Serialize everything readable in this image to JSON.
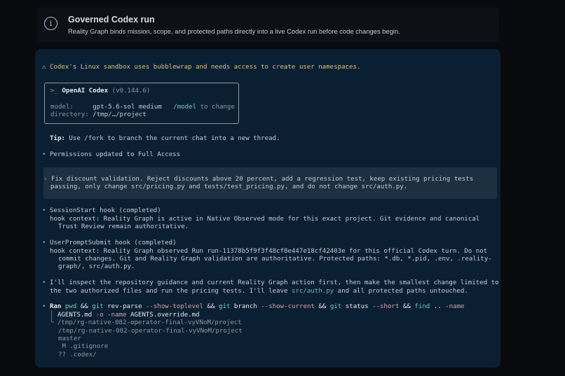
{
  "banner": {
    "icon": "info-icon",
    "title": "Governed Codex run",
    "description": "Reality Graph binds mission, scope, and protected paths directly into a live Codex run before code changes begin."
  },
  "terminal": {
    "warning": "⚠ Codex's Linux sandbox uses bubblewrap and needs access to create user namespaces.",
    "header": {
      "prompt": ">_",
      "app_name": "OpenAI Codex",
      "version": "(v0.144.6)",
      "model_label": "model:",
      "model_value": "gpt-5.6-sol medium",
      "model_cmd": "/model",
      "model_hint": "to change",
      "dir_label": "directory:",
      "dir_value": "/tmp/…/project"
    },
    "tip": {
      "label": "Tip:",
      "text": "Use /fork to branch the current chat into a new thread."
    },
    "permissions": "Permissions updated to Full Access",
    "user_prompt": {
      "line1": "Fix discount validation. Reject discounts above 20 percent, add a regression test, keep existing pricing tests",
      "line2": "passing, only change src/pricing.py and tests/test_pricing.py, and do not change src/auth.py."
    },
    "session_hook": {
      "title": "SessionStart hook (completed)",
      "line1": "hook context: Reality Graph is active in Native Observed mode for this exact project. Git evidence and canonical",
      "line2": "Trust Review remain authoritative."
    },
    "prompt_hook": {
      "title": "UserPromptSubmit hook (completed)",
      "line1": "hook context: Reality Graph observed Run run-11378b5f9f3f48cf8e447e18cf42403e for this official Codex turn. Do not",
      "line2": "commit changes. Git and Reality Graph validation are authoritative. Protected paths: *.db, *.pid, .env, .reality-",
      "line3": "graph/, src/auth.py."
    },
    "assistant": {
      "line1": "I'll inspect the repository guidance and current Reality Graph action first, then make the smallest change limited to",
      "line2_a": "the two authorized files and run the pricing tests. I'll leave",
      "line2_path": "src/auth.py",
      "line2_b": "and all protected paths untouched."
    },
    "command": {
      "ran": "Ran",
      "t1": "pwd",
      "t2": "&&",
      "t3": "git",
      "t4": "rev-parse",
      "t5": "--show-toplevel",
      "t6": "&&",
      "t7": "git",
      "t8": "branch",
      "t9": "--show-current",
      "t10": "&&",
      "t11": "git",
      "t12": "status",
      "t13": "--short",
      "t14": "&&",
      "t15": "find",
      "t16": "..",
      "t17": "-name",
      "l2_a": "AGENTS.md",
      "l2_b": "-o",
      "l2_c": "-name",
      "l2_d": "AGENTS.override.md"
    },
    "output": [
      "/tmp/rg-native-082-operator-final-vyVNoM/project",
      "/tmp/rg-native-082-operator-final-vyVNoM/project",
      "master",
      " M .gitignore",
      "?? .codex/"
    ]
  }
}
